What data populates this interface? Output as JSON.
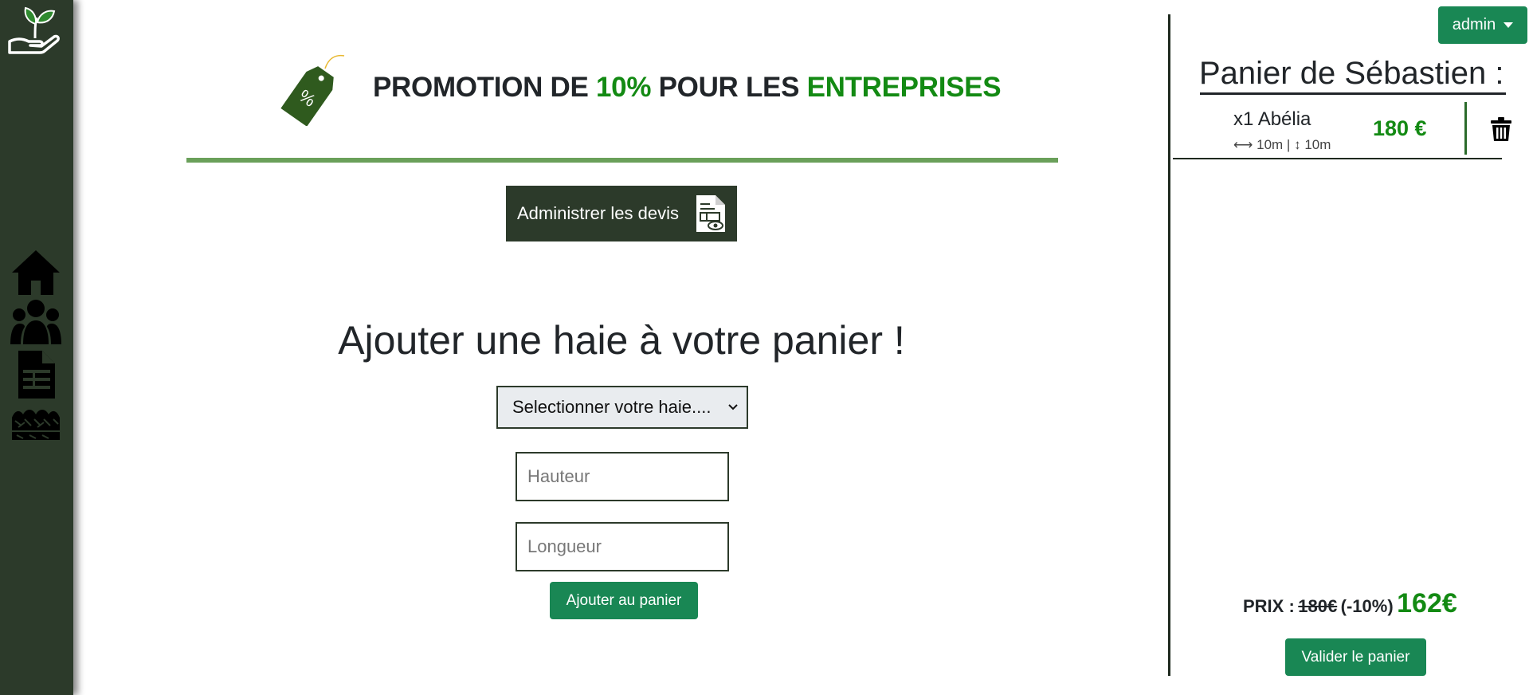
{
  "sidebar": {
    "items": [
      {
        "icon": "home-icon"
      },
      {
        "icon": "users-icon"
      },
      {
        "icon": "document-list-icon"
      },
      {
        "icon": "hedge-icon"
      }
    ],
    "bg_color": "#2c3a2a"
  },
  "promo": {
    "part1": "PROMOTION DE",
    "percent": "10%",
    "part2": "POUR LES",
    "part3": "ENTREPRISES",
    "tag_symbol": "%"
  },
  "devis_button": {
    "label": "Administrer les devis"
  },
  "form": {
    "title": "Ajouter une haie à votre panier !",
    "select_value": "Selectionner votre haie....",
    "height_placeholder": "Hauteur",
    "length_placeholder": "Longueur",
    "submit_label": "Ajouter au panier"
  },
  "user_menu": {
    "label": "admin"
  },
  "cart": {
    "title": "Panier de Sébastien :",
    "items": [
      {
        "name": "x1 Abélia",
        "width": "10m",
        "height": "10m",
        "price": "180 €"
      }
    ],
    "price_label": "PRIX :",
    "old_price": "180€",
    "discount": "(-10%)",
    "total": "162€",
    "validate_label": "Valider le panier"
  },
  "colors": {
    "accent_green": "#198754",
    "text_green": "#138a13",
    "dark": "#2c3a2a"
  }
}
